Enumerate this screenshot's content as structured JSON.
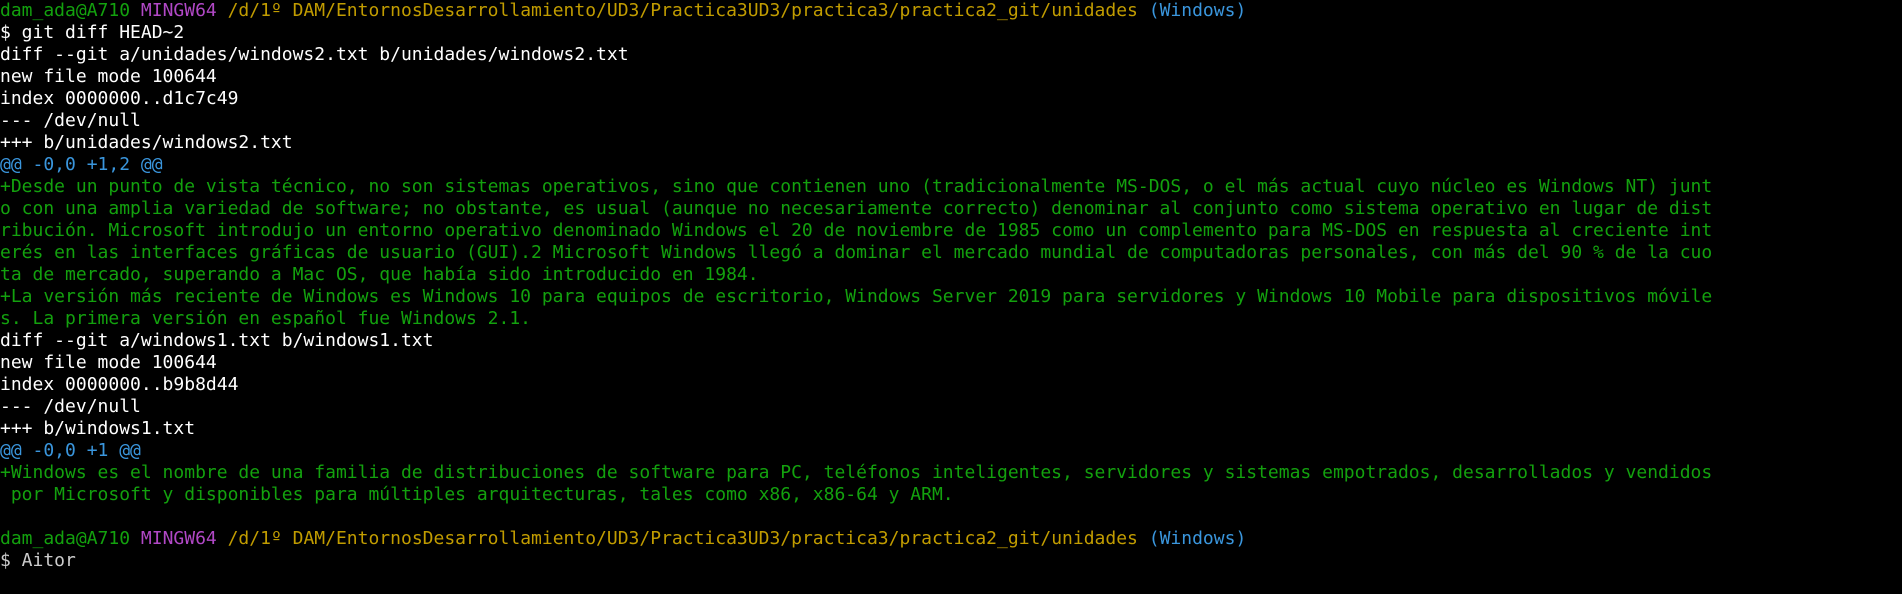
{
  "prompt1": {
    "user": "dam_ada@A710",
    "system": "MINGW64",
    "path": "/d/1º DAM/EntornosDesarrollamiento/UD3/Practica3UD3/practica3/practica2_git/unidades",
    "branch": "(Windows)",
    "command": "$ git diff HEAD~2"
  },
  "diff1": {
    "header": "diff --git a/unidades/windows2.txt b/unidades/windows2.txt",
    "mode": "new file mode 100644",
    "index": "index 0000000..d1c7c49",
    "old": "--- /dev/null",
    "new": "+++ b/unidades/windows2.txt",
    "hunk": "@@ -0,0 +1,2 @@",
    "added_lines": [
      "+Desde un punto de vista técnico, no son sistemas operativos, sino que contienen uno (tradicionalmente MS-DOS, o el más actual cuyo núcleo es Windows NT) junt",
      "o con una amplia variedad de software; no obstante, es usual (aunque no necesariamente correcto) denominar al conjunto como sistema operativo en lugar de dist",
      "ribución. Microsoft introdujo un entorno operativo denominado Windows el 20 de noviembre de 1985 como un complemento para MS-DOS en respuesta al creciente int",
      "erés en las interfaces gráficas de usuario (GUI).2 Microsoft Windows llegó a dominar el mercado mundial de computadoras personales, con más del 90 % de la cuo",
      "ta de mercado, superando a Mac OS, que había sido introducido en 1984.",
      "+La versión más reciente de Windows es Windows 10 para equipos de escritorio, Windows Server 2019 para servidores y Windows 10 Mobile para dispositivos móvile",
      "s. La primera versión en español fue Windows 2.1."
    ]
  },
  "diff2": {
    "header": "diff --git a/windows1.txt b/windows1.txt",
    "mode": "new file mode 100644",
    "index": "index 0000000..b9b8d44",
    "old": "--- /dev/null",
    "new": "+++ b/windows1.txt",
    "hunk": "@@ -0,0 +1 @@",
    "added_lines": [
      "+Windows es el nombre de una familia de distribuciones de software para PC, teléfonos inteligentes, servidores y sistemas empotrados, desarrollados y vendidos",
      " por Microsoft y disponibles para múltiples arquitecturas, tales como x86, x86-64 y ARM."
    ]
  },
  "prompt2": {
    "user": "dam_ada@A710",
    "system": "MINGW64",
    "path": "/d/1º DAM/EntornosDesarrollamiento/UD3/Practica3UD3/practica3/practica2_git/unidades",
    "branch": "(Windows)",
    "input": "$ Aitor"
  },
  "colors": {
    "background": "#000000",
    "user": "#13a10e",
    "system": "#b148c6",
    "path": "#c19c00",
    "branch": "#3a96dd",
    "added": "#13a10e",
    "hunk": "#3a96dd",
    "text": "#ffffff"
  }
}
